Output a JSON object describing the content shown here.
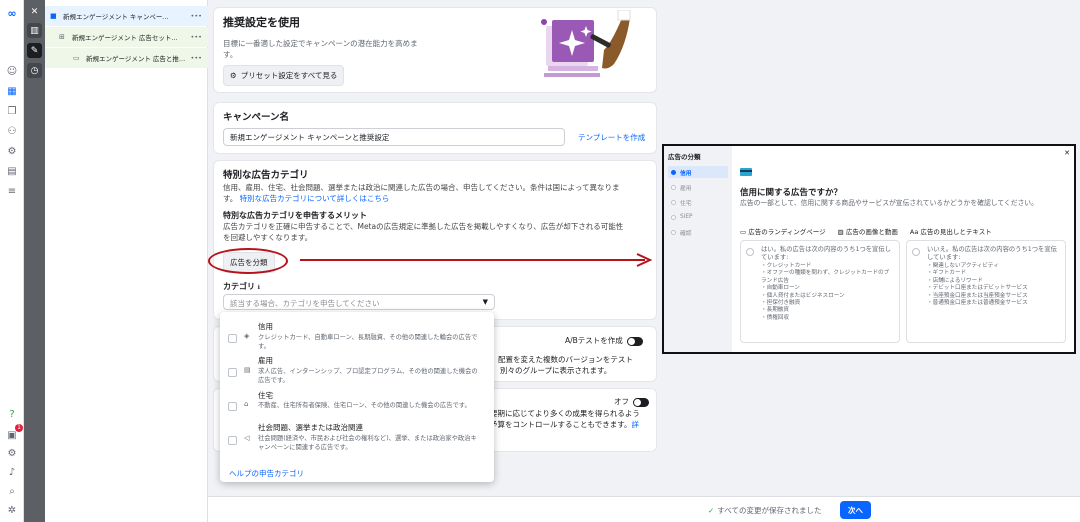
{
  "rail": {
    "badge_count": "1",
    "help_glyph": "?"
  },
  "tree": {
    "items": [
      {
        "label": "新規エンゲージメント キャンペーンと..."
      },
      {
        "label": "新規エンゲージメント 広告セット..."
      },
      {
        "label": "新規エンゲージメント 広告と推..."
      }
    ],
    "more": "•••"
  },
  "recommend": {
    "title": "推奨設定を使用",
    "desc": "目標に一番適した設定でキャンペーンの潜在能力を高めま",
    "desc2": "す。",
    "button": "プリセット設定をすべて見る"
  },
  "campaign_name": {
    "title": "キャンペーン名",
    "value": "新規エンゲージメント キャンペーンと推奨設定",
    "template_link": "テンプレートを作成"
  },
  "special_category": {
    "title": "特別な広告カテゴリ",
    "desc": "信用、雇用、住宅、社会問題、選挙または政治に関連した広告の場合、申告してください。条件は国によって異なりま",
    "desc2_prefix": "す。",
    "learn_more": "特別な広告カテゴリについて詳しくはこちら",
    "benefit_title": "特別な広告カテゴリを申告するメリット",
    "benefit_desc": "広告カテゴリを正確に申告することで、Metaの広告規定に準拠した広告を掲載しやすくなり、広告が却下される可能性",
    "benefit_desc2": "を回避しやすくなります。",
    "classify_button": "広告を分類",
    "category_label": "カテゴリ",
    "category_info": "ℹ",
    "category_placeholder": "該当する場合、カテゴリを申告してください"
  },
  "dropdown": {
    "options": [
      {
        "title": "信用",
        "desc": "クレジットカード、自動車ローン、長期融資、その他の関連した輪会の広告です。"
      },
      {
        "title": "雇用",
        "desc": "求人広告、インターンシップ、プロ認定プログラム、その他の関連した機会の広告です。"
      },
      {
        "title": "住宅",
        "desc": "不動産、住宅所有者保険、住宅ローン、その他の関連した機会の広告です。"
      },
      {
        "title": "社会問題、選挙または政治関連",
        "desc": "社会問題(経済や、市民および社会の権利など)、選挙、または政治家や政治キャンペーンに関連する広告です。"
      }
    ],
    "help_link": "ヘルプの申告カテゴリ"
  },
  "abtest": {
    "label": "A/Bテストを作成",
    "partial_line1": "配置を変えた複数のバージョンをテスト",
    "partial_line2": "別々のグループに表示されます。"
  },
  "budget": {
    "off_label": "オフ",
    "partial_line1": "要期に応じてより多くの成果を得られるよう",
    "partial_line2": "予算をコントロールすることもできます。",
    "partial_link": "詳"
  },
  "bottom": {
    "saved": "すべての変更が保存されました",
    "next": "次へ"
  },
  "overlay": {
    "sidebar_title": "広告の分類",
    "items": [
      "信用",
      "雇用",
      "住宅",
      "SIEP",
      "確認"
    ],
    "active_index": 0,
    "question": "信用に関する広告ですか？",
    "desc": "広告の一部として、信用に関する商品やサービスが宣伝されているかどうかを確認してください。",
    "tabs": [
      "広告のランディングページ",
      "広告の画像と動画",
      "広告の見出しとテキスト"
    ],
    "yes": {
      "title": "はい。私の広告は次の内容のうち1つを宣伝しています:",
      "items": [
        "クレジットカード",
        "オファーの種類を問わず、クレジットカードのブランド広告",
        "自動車ローン",
        "個人貸付またはビジネスローン",
        "担保付き融資",
        "長期融資",
        "債権回収"
      ]
    },
    "no": {
      "title": "いいえ。私の広告は次の内容のうち1つを宣伝しています:",
      "items": [
        "関連しないアクティビティ",
        "ギフトカード",
        "店舗によるリワード",
        "デビット口座またはデビットサービス",
        "当座預金口座または当座預金サービス",
        "普通預金口座または普通預金サービス"
      ]
    }
  }
}
